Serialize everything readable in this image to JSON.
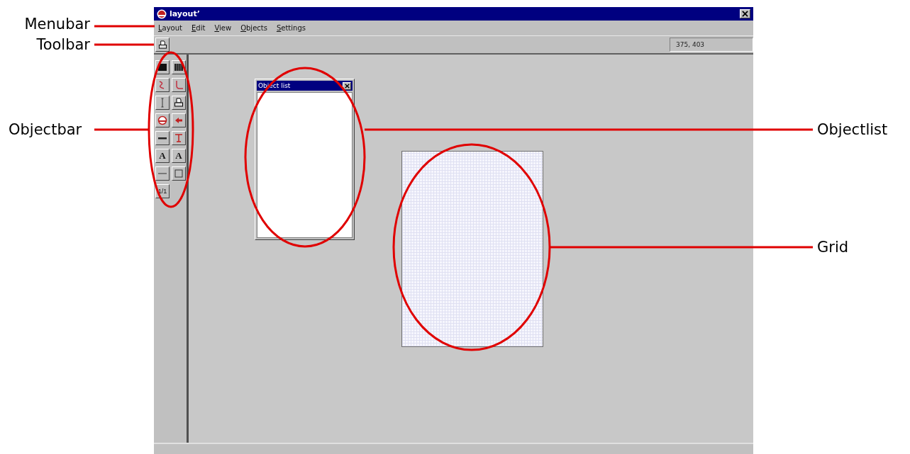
{
  "window": {
    "title": "layout’"
  },
  "menu": [
    "Layout",
    "Edit",
    "View",
    "Objects",
    "Settings"
  ],
  "toolbar": {
    "coordinates": "375, 403"
  },
  "objectbar": {
    "tools": [
      {
        "kind": "fill"
      },
      {
        "kind": "hatch"
      },
      {
        "kind": "curve"
      },
      {
        "kind": "corner"
      },
      {
        "kind": "ibeam"
      },
      {
        "kind": "printer"
      },
      {
        "kind": "circle"
      },
      {
        "kind": "arrow"
      },
      {
        "kind": "thick"
      },
      {
        "kind": "tbar"
      },
      {
        "kind": "text",
        "label": "A"
      },
      {
        "kind": "text",
        "label": "A"
      },
      {
        "kind": "line"
      },
      {
        "kind": "square"
      },
      {
        "kind": "text",
        "label": "1/1"
      }
    ]
  },
  "object_list": {
    "title": "Object list"
  },
  "annotations": [
    {
      "label": "Menubar"
    },
    {
      "label": "Toolbar"
    },
    {
      "label": "Objectbar"
    },
    {
      "label": "Objectlist"
    },
    {
      "label": "Grid"
    }
  ]
}
